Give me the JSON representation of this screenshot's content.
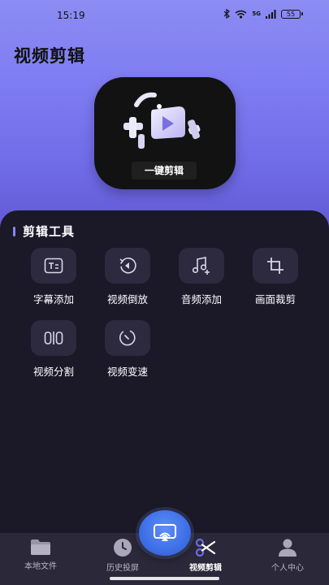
{
  "status_bar": {
    "time": "15:19",
    "network": "5G",
    "battery": "55"
  },
  "page_title": "视频剪辑",
  "hero": {
    "button_label": "一键剪辑"
  },
  "tools_section": {
    "title": "剪辑工具",
    "tools": [
      {
        "label": "字幕添加",
        "icon": "subtitle-icon"
      },
      {
        "label": "视频倒放",
        "icon": "reverse-icon"
      },
      {
        "label": "音频添加",
        "icon": "music-add-icon"
      },
      {
        "label": "画面裁剪",
        "icon": "crop-icon"
      },
      {
        "label": "视频分割",
        "icon": "split-icon"
      },
      {
        "label": "视频变速",
        "icon": "speed-icon"
      }
    ]
  },
  "nav": {
    "items": [
      {
        "label": "本地文件",
        "icon": "folder-icon"
      },
      {
        "label": "历史投屏",
        "icon": "clock-icon"
      },
      {
        "label": "视频剪辑",
        "icon": "scissors-icon",
        "active": true
      },
      {
        "label": "个人中心",
        "icon": "user-icon"
      }
    ],
    "fab_icon": "cast-icon"
  },
  "colors": {
    "accent": "#7e7cf2",
    "panel": "#1b1828",
    "tile": "#2d2a40",
    "fab": "#3e6fe6"
  }
}
